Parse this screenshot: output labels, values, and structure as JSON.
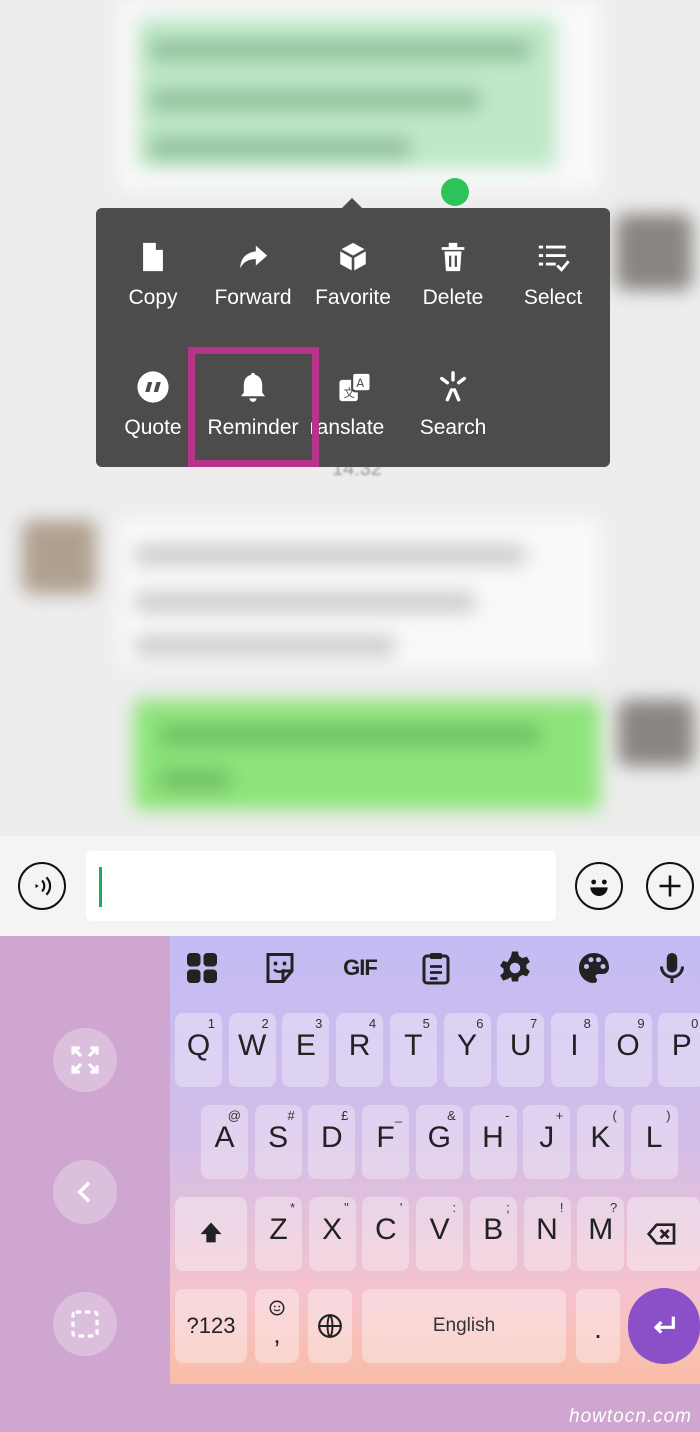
{
  "chat": {
    "timestamp": "14:32"
  },
  "context_menu": {
    "row1": [
      {
        "label": "Copy",
        "icon": "file-icon"
      },
      {
        "label": "Forward",
        "icon": "forward-arrow-icon"
      },
      {
        "label": "Favorite",
        "icon": "cube-icon"
      },
      {
        "label": "Delete",
        "icon": "trash-icon"
      },
      {
        "label": "Select",
        "icon": "checklist-icon"
      }
    ],
    "row2": [
      {
        "label": "Quote",
        "icon": "quote-icon"
      },
      {
        "label": "Reminder",
        "icon": "bell-icon",
        "highlighted": true
      },
      {
        "label": "ranslate",
        "icon": "translate-icon"
      },
      {
        "label": "Search",
        "icon": "sparkle-icon"
      }
    ],
    "highlight_color": "#b8338a"
  },
  "input_bar": {
    "voice_icon": "voice-icon",
    "emoji_icon": "emoji-icon",
    "plus_icon": "plus-icon",
    "caret_color": "#1aad5b"
  },
  "keyboard": {
    "toolbar": [
      "apps-grid-icon",
      "sticker-icon",
      "GIF",
      "clipboard-icon",
      "gear-icon",
      "palette-icon",
      "mic-icon"
    ],
    "row1": [
      {
        "k": "Q",
        "s": "1"
      },
      {
        "k": "W",
        "s": "2"
      },
      {
        "k": "E",
        "s": "3"
      },
      {
        "k": "R",
        "s": "4"
      },
      {
        "k": "T",
        "s": "5"
      },
      {
        "k": "Y",
        "s": "6"
      },
      {
        "k": "U",
        "s": "7"
      },
      {
        "k": "I",
        "s": "8"
      },
      {
        "k": "O",
        "s": "9"
      },
      {
        "k": "P",
        "s": "0"
      }
    ],
    "row2": [
      {
        "k": "A",
        "s": "@"
      },
      {
        "k": "S",
        "s": "#"
      },
      {
        "k": "D",
        "s": "£"
      },
      {
        "k": "F",
        "s": "_"
      },
      {
        "k": "G",
        "s": "&"
      },
      {
        "k": "H",
        "s": "-"
      },
      {
        "k": "J",
        "s": "+"
      },
      {
        "k": "K",
        "s": "("
      },
      {
        "k": "L",
        "s": ")"
      }
    ],
    "row3": [
      {
        "k": "Z",
        "s": "*"
      },
      {
        "k": "X",
        "s": "\""
      },
      {
        "k": "C",
        "s": "'"
      },
      {
        "k": "V",
        "s": ":"
      },
      {
        "k": "B",
        "s": ";"
      },
      {
        "k": "N",
        "s": "!"
      },
      {
        "k": "M",
        "s": "?"
      }
    ],
    "symbols_key": "?123",
    "comma_key": ",",
    "space_label": "English",
    "period_key": ".",
    "enter_color": "#8b50c8"
  },
  "watermark": "howtocn.com"
}
